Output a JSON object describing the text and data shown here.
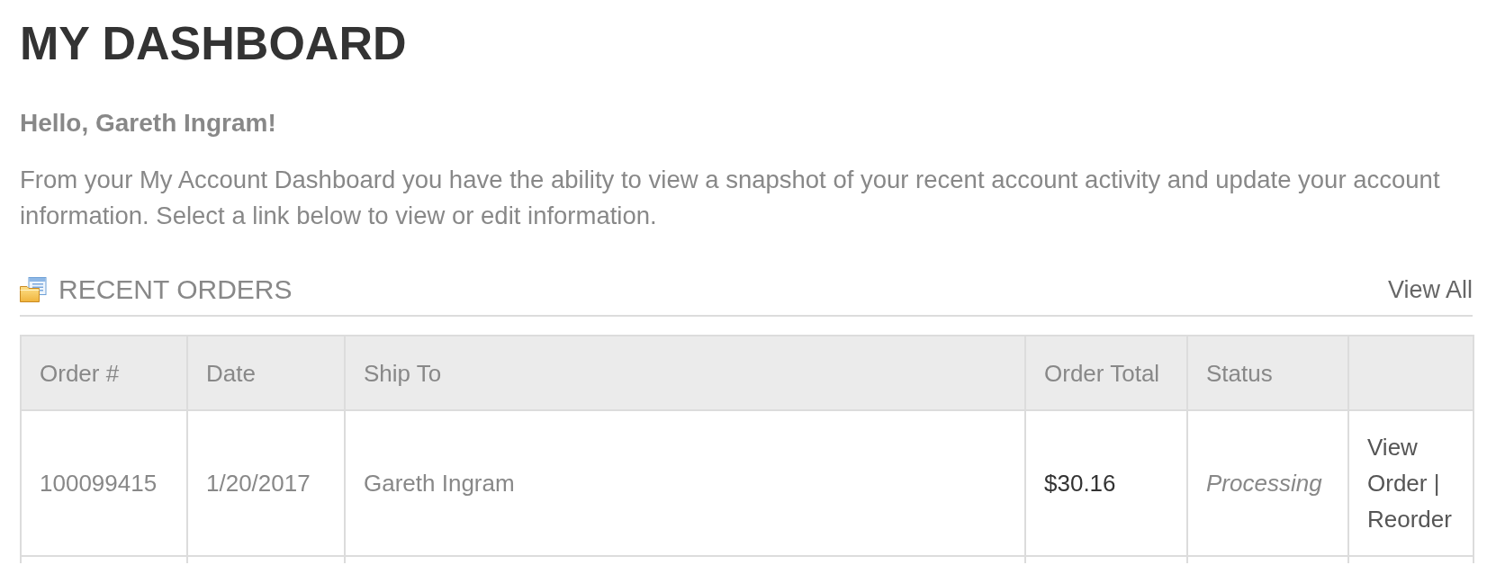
{
  "page": {
    "title": "MY DASHBOARD",
    "greeting": "Hello, Gareth Ingram!",
    "intro": "From your My Account Dashboard you have the ability to view a snapshot of your recent account activity and update your account information. Select a link below to view or edit information."
  },
  "recent_orders": {
    "heading": "RECENT ORDERS",
    "view_all_link": "View All",
    "table": {
      "columns": [
        "Order #",
        "Date",
        "Ship To",
        "Order Total",
        "Status"
      ],
      "rows": [
        {
          "order_number": "100099415",
          "date": "1/20/2017",
          "ship_to": "Gareth Ingram",
          "order_total": "$30.16",
          "status": "Processing",
          "actions": [
            {
              "label": "View Order"
            },
            {
              "label": "Reorder"
            }
          ],
          "action_separator": "|"
        }
      ]
    }
  }
}
